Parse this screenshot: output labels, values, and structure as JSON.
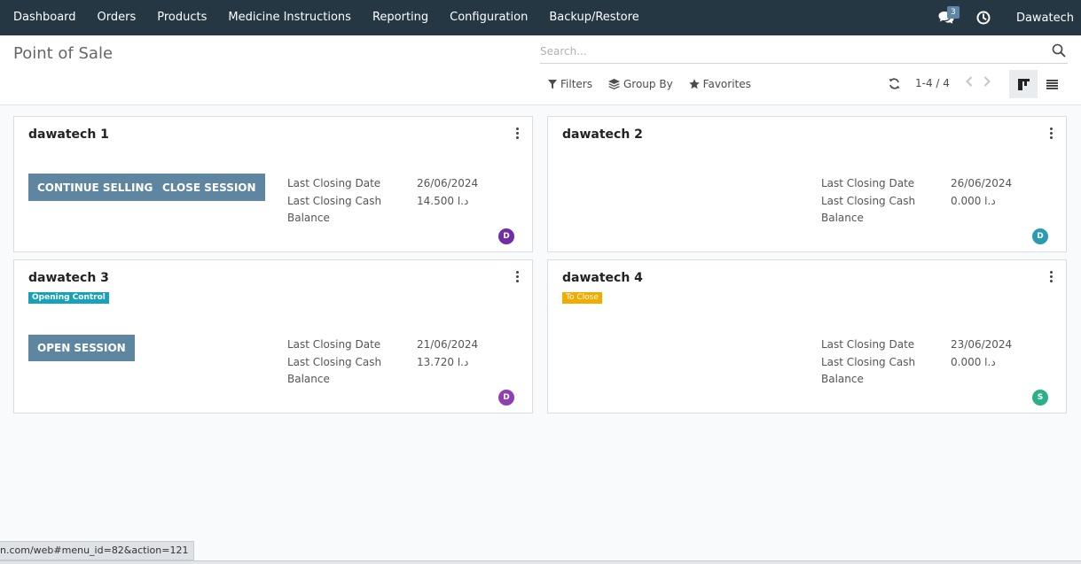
{
  "navbar": {
    "menu": [
      {
        "label": "Dashboard"
      },
      {
        "label": "Orders"
      },
      {
        "label": "Products"
      },
      {
        "label": "Medicine Instructions"
      },
      {
        "label": "Reporting"
      },
      {
        "label": "Configuration"
      },
      {
        "label": "Backup/Restore"
      }
    ],
    "chat_icon": "chat-bubbles-icon",
    "chat_count": "3",
    "activity_icon": "clock-icon",
    "user_name": "Dawatech"
  },
  "control_panel": {
    "title": "Point of Sale",
    "search_placeholder": "Search...",
    "filters_label": "Filters",
    "group_by_label": "Group By",
    "favorites_label": "Favorites",
    "pager_value": "1-4 / 4"
  },
  "cards": [
    {
      "name": "dawatech 1",
      "buttons": [
        "CONTINUE SELLING",
        "CLOSE SESSION"
      ],
      "last_closing_date_label": "Last Closing Date",
      "last_closing_date": "26/06/2024",
      "last_closing_cash_label": "Last Closing Cash",
      "last_closing_cash": "14.500  د.ا",
      "balance_label": "Balance",
      "avatar_letter": "D",
      "avatar_color": "#6f2da8"
    },
    {
      "name": "dawatech 2",
      "last_closing_date_label": "Last Closing Date",
      "last_closing_date": "26/06/2024",
      "last_closing_cash_label": "Last Closing Cash",
      "last_closing_cash": "0.000  د.ا",
      "balance_label": "Balance",
      "avatar_letter": "D",
      "avatar_color": "#2a9bb2"
    },
    {
      "name": "dawatech 3",
      "badge": "Opening Control",
      "buttons": [
        "OPEN SESSION"
      ],
      "last_closing_date_label": "Last Closing Date",
      "last_closing_date": "21/06/2024",
      "last_closing_cash_label": "Last Closing Cash",
      "last_closing_cash": "13.720  د.ا",
      "balance_label": "Balance",
      "avatar_letter": "D",
      "avatar_color": "#8e3fb0"
    },
    {
      "name": "dawatech 4",
      "badge": "To Close",
      "last_closing_date_label": "Last Closing Date",
      "last_closing_date": "23/06/2024",
      "last_closing_cash_label": "Last Closing Cash",
      "last_closing_cash": "0.000  د.ا",
      "balance_label": "Balance",
      "avatar_letter": "S",
      "avatar_color": "#2ab08a"
    }
  ],
  "status_bar": {
    "url_text": "n.com/web#menu_id=82&action=121"
  }
}
